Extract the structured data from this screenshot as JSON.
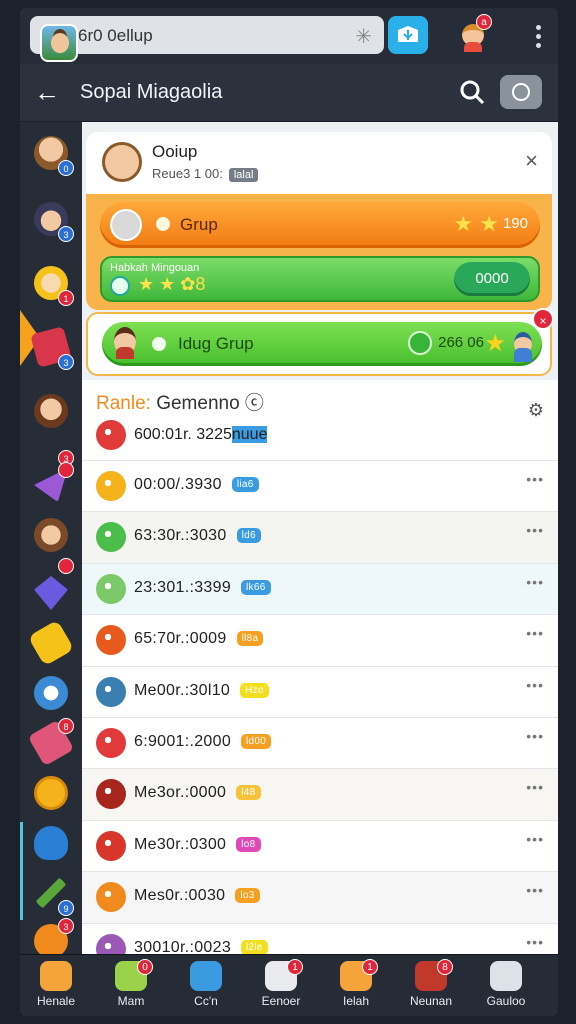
{
  "topbar": {
    "search_text": "6r0 0ellup",
    "badge_count": "a"
  },
  "header": {
    "back_label": "←",
    "title": "Sopai Miagaolia"
  },
  "sidebar": {
    "badges": [
      "0",
      "3",
      "1",
      "3",
      "3",
      "",
      "",
      "",
      "",
      "8",
      "",
      "9",
      "3"
    ]
  },
  "card": {
    "name": "Ooiup",
    "sub": "Reue3 1 00:",
    "tag": "lalal",
    "close": "×"
  },
  "orange_bar": {
    "label": "Grup",
    "stars": "★ ★",
    "value": "190"
  },
  "green_bar": {
    "small": "Habkah Mingouan",
    "stars": "★ ★ ✿8",
    "pill": "0000"
  },
  "group_bar": {
    "label": "Idug Grup",
    "count": "266 06",
    "close": "×"
  },
  "list": {
    "title_prefix": "Ranle:",
    "title": " Gemenno",
    "rows": [
      {
        "time": "600:01r. 3225",
        "tag": "nuue",
        "tag_color": "#3b9be0",
        "icon_color": "#e03a3a",
        "dots": ""
      },
      {
        "time": "00:00/.3930",
        "tag": "lia6",
        "tag_color": "#3b9be0",
        "icon_color": "#f5b21a",
        "dots": "•••"
      },
      {
        "time": "63:30r.:3030",
        "tag": "ld6",
        "tag_color": "#3b9be0",
        "icon_color": "#4bbd4a",
        "dots": "•••"
      },
      {
        "time": "23:301.:3399",
        "tag": "lk66",
        "tag_color": "#3b9be0",
        "icon_color": "#7cc96a",
        "dots": "•••"
      },
      {
        "time": "65:70r.:0009",
        "tag": "ll8a",
        "tag_color": "#f5a020",
        "icon_color": "#e8591c",
        "dots": "•••"
      },
      {
        "time": "Me00r.:30l10",
        "tag": "Hzo",
        "tag_color": "#f2e01e",
        "icon_color": "#3a7fb0",
        "dots": "•••"
      },
      {
        "time": "6:9001:.2000",
        "tag": "ld00",
        "tag_color": "#f5a020",
        "icon_color": "#e03a3a",
        "dots": "•••"
      },
      {
        "time": "Me3or.:0000",
        "tag": "l48",
        "tag_color": "#f5c23a",
        "icon_color": "#a8261c",
        "dots": "•••"
      },
      {
        "time": "Me30r.:0300",
        "tag": "lo8",
        "tag_color": "#e04ab8",
        "icon_color": "#d8362a",
        "dots": "•••"
      },
      {
        "time": "Mes0r.:0030",
        "tag": "lo3",
        "tag_color": "#f5a020",
        "icon_color": "#f08a1c",
        "dots": "•••"
      },
      {
        "time": "30010r.:0023",
        "tag": "l2le",
        "tag_color": "#f2e01e",
        "icon_color": "#9b59b6",
        "dots": "•••"
      }
    ]
  },
  "bottom_nav": [
    {
      "label": "Henale",
      "badge": "",
      "color": "#f5a33b"
    },
    {
      "label": "Mam",
      "badge": "0",
      "color": "#9ad24a"
    },
    {
      "label": "Cc'n",
      "badge": "",
      "color": "#3b9be0"
    },
    {
      "label": "Eenoer",
      "badge": "1",
      "color": "#e8eaee"
    },
    {
      "label": "Ielah",
      "badge": "1",
      "color": "#f5a33b"
    },
    {
      "label": "Neunan",
      "badge": "8",
      "color": "#c0392b"
    },
    {
      "label": "Gauloo",
      "badge": "",
      "color": "#dde2e8"
    }
  ],
  "colors": {
    "accent_orange": "#f7a21b",
    "accent_green": "#46bf2e",
    "badge_red": "#e0263a",
    "blue": "#2ab0e8"
  }
}
